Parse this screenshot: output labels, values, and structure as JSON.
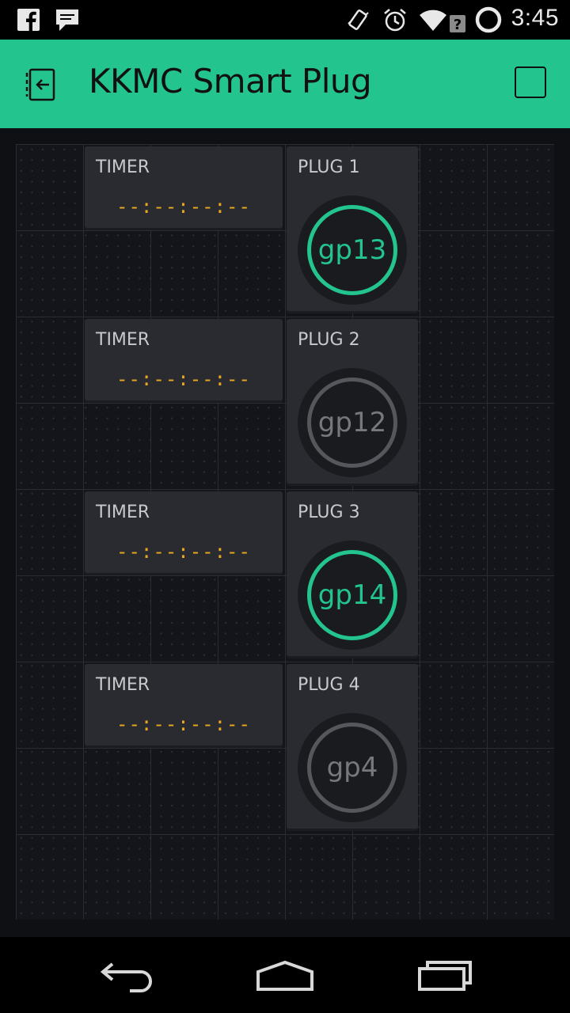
{
  "status_bar": {
    "time": "3:45",
    "left_icons": [
      "facebook-icon",
      "chat-icon"
    ],
    "right_icons": [
      "vibrate-icon",
      "alarm-icon",
      "wifi-icon",
      "sync-icon"
    ]
  },
  "app_bar": {
    "title": "KKMC Smart Plug",
    "background": "#23c48e"
  },
  "rows": [
    {
      "timer": {
        "label": "TIMER",
        "value": "--:--:--:--"
      },
      "plug": {
        "label": "PLUG 1",
        "button": "gp13",
        "state": "on"
      }
    },
    {
      "timer": {
        "label": "TIMER",
        "value": "--:--:--:--"
      },
      "plug": {
        "label": "PLUG 2",
        "button": "gp12",
        "state": "off"
      }
    },
    {
      "timer": {
        "label": "TIMER",
        "value": "--:--:--:--"
      },
      "plug": {
        "label": "PLUG 3",
        "button": "gp14",
        "state": "on"
      }
    },
    {
      "timer": {
        "label": "TIMER",
        "value": "--:--:--:--"
      },
      "plug": {
        "label": "PLUG 4",
        "button": "gp4",
        "state": "off"
      }
    }
  ],
  "colors": {
    "accent": "#23c48e",
    "timer_text": "#eba81f",
    "off_ring": "#56575c"
  },
  "nav_bar": {
    "icons": [
      "back-icon",
      "home-icon",
      "recents-icon"
    ]
  }
}
